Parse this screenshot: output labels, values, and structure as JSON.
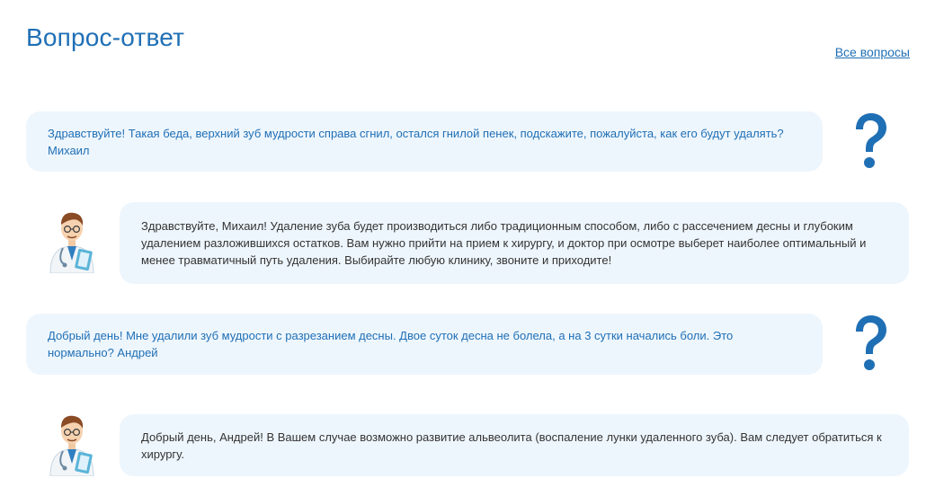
{
  "header": {
    "title": "Вопрос-ответ",
    "all_questions_link": "Все вопросы"
  },
  "colors": {
    "accent": "#1f6fb5",
    "bubble_bg": "#eef6fd",
    "answer_text": "#333333"
  },
  "qa": [
    {
      "question": "Здравствуйте! Такая беда, верхний зуб мудрости справа сгнил, остался гнилой пенек, подскажите, пожалуйста, как его будут удалять? Михаил",
      "answer": "Здравствуйте, Михаил! Удаление зуба будет производиться либо традиционным способом, либо с рассечением десны и глубоким удалением разложившихся остатков. Вам нужно прийти на прием к хирургу, и доктор при осмотре выберет наиболее оптимальный и менее травматичный путь удаления. Выбирайте любую клинику, звоните и приходите!"
    },
    {
      "question": "Добрый день! Мне удалили зуб мудрости с разрезанием десны. Двое суток десна не болела, а на 3 сутки начались боли. Это нормально? Андрей",
      "answer": "Добрый день, Андрей! В Вашем случае возможно развитие альвеолита (воспаление лунки удаленного зуба). Вам следует обратиться к хирургу."
    }
  ],
  "icons": {
    "question": "question-mark-icon",
    "doctor": "doctor-avatar-icon"
  }
}
